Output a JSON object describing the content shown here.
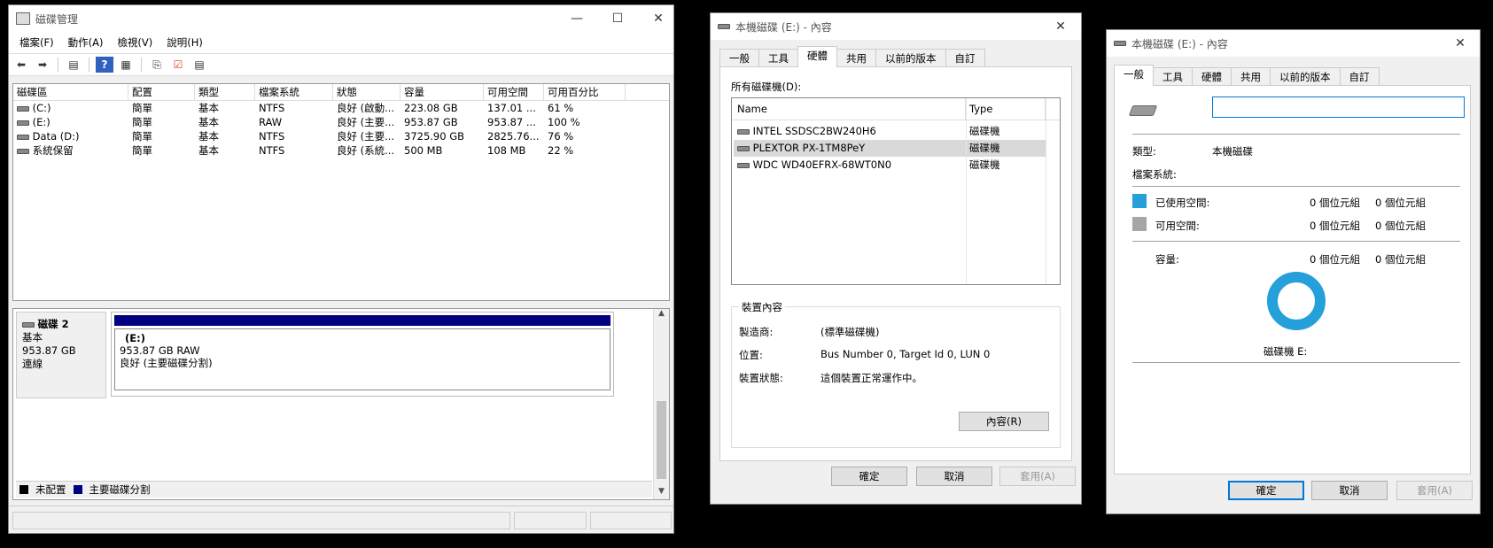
{
  "disk_mgmt": {
    "title": "磁碟管理",
    "menu": [
      "檔案(F)",
      "動作(A)",
      "檢視(V)",
      "說明(H)"
    ],
    "columns": [
      "磁碟區",
      "配置",
      "類型",
      "檔案系統",
      "狀態",
      "容量",
      "可用空間",
      "可用百分比"
    ],
    "volumes": [
      [
        "(C:)",
        "簡單",
        "基本",
        "NTFS",
        "良好 (啟動...",
        "223.08 GB",
        "137.01 ...",
        "61 %"
      ],
      [
        "(E:)",
        "簡單",
        "基本",
        "RAW",
        "良好 (主要...",
        "953.87 GB",
        "953.87 ...",
        "100 %"
      ],
      [
        "Data (D:)",
        "簡單",
        "基本",
        "NTFS",
        "良好 (主要...",
        "3725.90 GB",
        "2825.76...",
        "76 %"
      ],
      [
        "系統保留",
        "簡單",
        "基本",
        "NTFS",
        "良好 (系統...",
        "500 MB",
        "108 MB",
        "22 %"
      ]
    ],
    "disk": {
      "name": "磁碟 2",
      "type": "基本",
      "size": "953.87 GB",
      "status": "連線",
      "partition_label": "(E:)",
      "partition_size": "953.87 GB RAW",
      "partition_status": "良好 (主要磁碟分割)"
    },
    "legend": [
      {
        "label": "未配置",
        "color": "#000000"
      },
      {
        "label": "主要磁碟分割",
        "color": "#000080"
      }
    ]
  },
  "props_hw": {
    "title": "本機磁碟 (E:) - 內容",
    "tabs": [
      "一般",
      "工具",
      "硬體",
      "共用",
      "以前的版本",
      "自訂"
    ],
    "active_tab": "硬體",
    "all_disks_label": "所有磁碟機(D):",
    "list_headers": [
      "Name",
      "Type"
    ],
    "drives": [
      {
        "name": "INTEL SSDSC2BW240H6",
        "type": "磁碟機"
      },
      {
        "name": "PLEXTOR PX-1TM8PeY",
        "type": "磁碟機"
      },
      {
        "name": "WDC WD40EFRX-68WT0N0",
        "type": "磁碟機"
      }
    ],
    "group_title": "裝置內容",
    "manufacturer_label": "製造商:",
    "manufacturer": "(標準磁碟機)",
    "location_label": "位置:",
    "location": "Bus Number 0, Target Id 0, LUN 0",
    "device_status_label": "裝置狀態:",
    "device_status": "這個裝置正常運作中。",
    "properties_button": "內容(R)",
    "ok": "確定",
    "cancel": "取消",
    "apply": "套用(A)"
  },
  "props_gen": {
    "title": "本機磁碟 (E:) - 內容",
    "tabs": [
      "一般",
      "工具",
      "硬體",
      "共用",
      "以前的版本",
      "自訂"
    ],
    "active_tab": "一般",
    "name_value": "",
    "type_label": "類型:",
    "type_value": "本機磁碟",
    "fs_label": "檔案系統:",
    "used_label": "已使用空間:",
    "used_bytes": "0 個位元組",
    "used_size": "0 個位元組",
    "free_label": "可用空間:",
    "free_bytes": "0 個位元組",
    "free_size": "0 個位元組",
    "cap_label": "容量:",
    "cap_bytes": "0 個位元組",
    "cap_size": "0 個位元組",
    "drive_caption": "磁碟機 E:",
    "used_color": "#26a0da",
    "free_color": "#a6a6a6",
    "ok": "確定",
    "cancel": "取消",
    "apply": "套用(A)"
  }
}
